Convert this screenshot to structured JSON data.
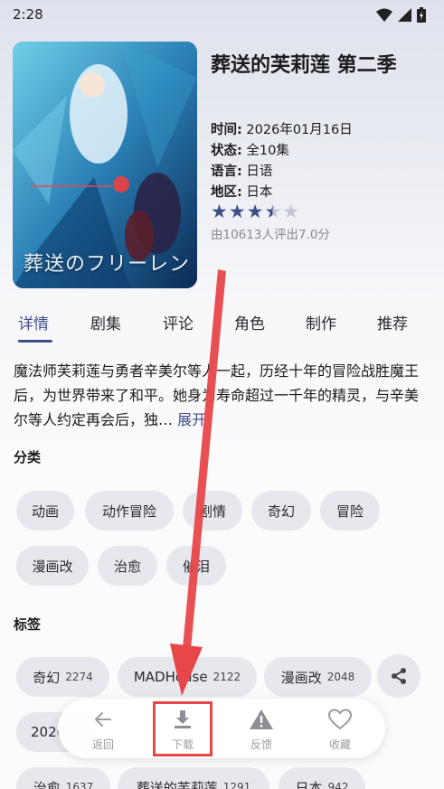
{
  "status_bar": {
    "time": "2:28"
  },
  "anime": {
    "title": "葬送的芙莉莲 第二季",
    "poster_text": "葬送のフリーレン",
    "date_label": "时间:",
    "date": "2026年01月16日",
    "status_label": "状态:",
    "status": "全10集",
    "language_label": "语言:",
    "language": "日语",
    "region_label": "地区:",
    "region": "日本",
    "stars_filled": 3.5,
    "stars_total": 5,
    "rating_text": "由10613人评出7.0分"
  },
  "tabs": [
    {
      "label": "详情"
    },
    {
      "label": "剧集"
    },
    {
      "label": "评论"
    },
    {
      "label": "角色"
    },
    {
      "label": "制作"
    },
    {
      "label": "推荐"
    }
  ],
  "description": {
    "text": "魔法师芙莉莲与勇者辛美尔等人一起，历经十年的冒险战胜魔王后，为世界带来了和平。她身为寿命超过一千年的精灵，与辛美尔等人约定再会后，独…",
    "expand_label": "展开"
  },
  "categories": {
    "title": "分类",
    "items": [
      "动画",
      "动作冒险",
      "剧情",
      "奇幻",
      "冒险",
      "漫画改",
      "治愈",
      "催泪"
    ]
  },
  "tags": {
    "title": "标签",
    "items": [
      {
        "label": "奇幻",
        "count": "2274"
      },
      {
        "label": "MADHouse",
        "count": "2122"
      },
      {
        "label": "漫画改",
        "count": "2048"
      },
      {
        "label": "2026",
        "count": ""
      },
      {
        "label": "治愈",
        "count": "1637"
      },
      {
        "label": "葬送的芙莉莲",
        "count": "1291"
      },
      {
        "label": "日本",
        "count": "942"
      }
    ]
  },
  "bottom_bar": {
    "back_label": "返回",
    "download_label": "下载",
    "feedback_label": "反馈",
    "favorite_label": "收藏"
  },
  "colors": {
    "accent": "#3e4f88",
    "chip_bg": "#e7e8ee",
    "annotation_red": "#e8474a"
  }
}
